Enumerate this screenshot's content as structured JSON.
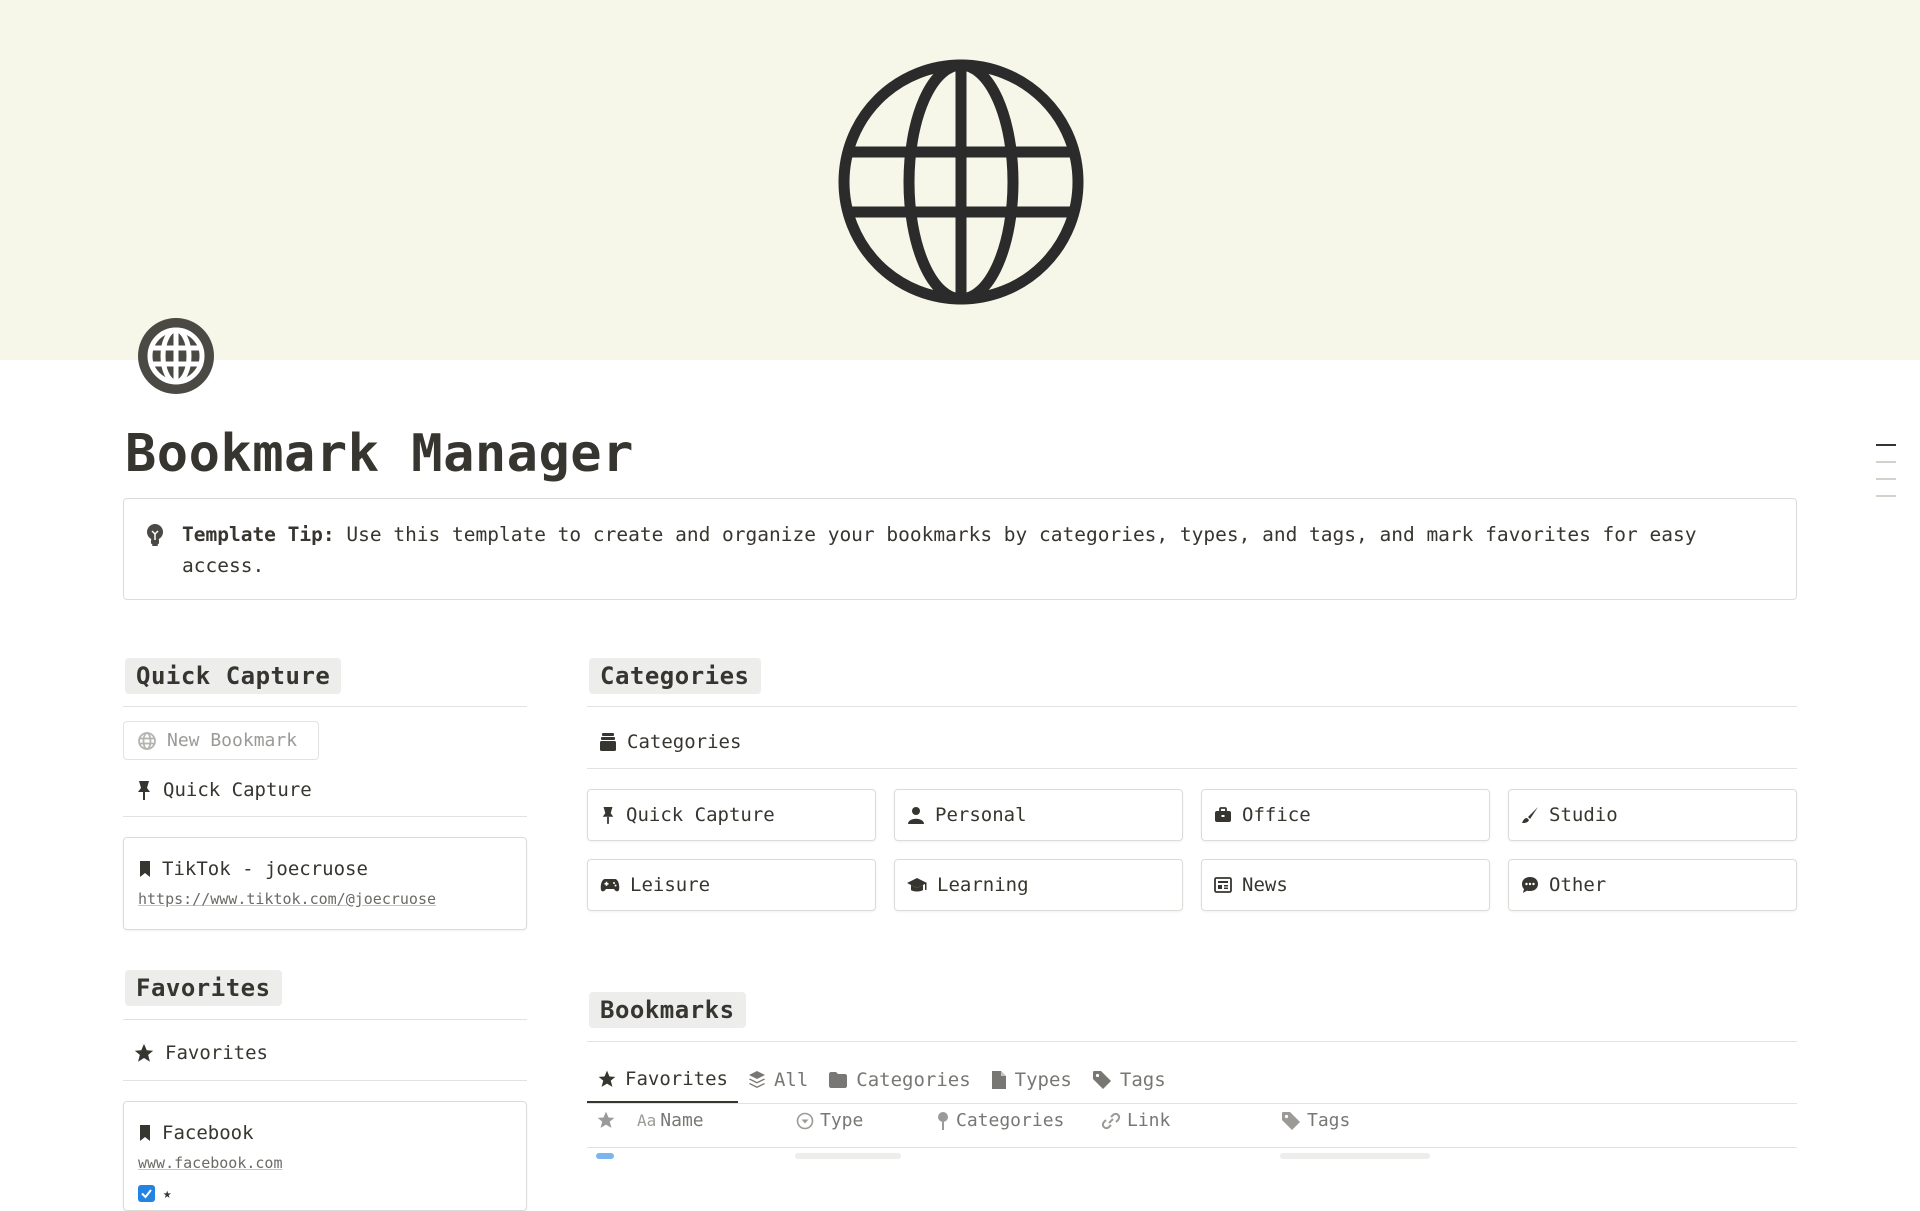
{
  "page": {
    "title": "Bookmark Manager",
    "icon": "globe-icon"
  },
  "callout": {
    "icon": "lightbulb-icon",
    "label": "Template Tip:",
    "text": " Use this template to create and organize your bookmarks by categories, types, and tags, and mark favorites for easy access."
  },
  "quick_capture": {
    "heading": "Quick Capture",
    "new_button": "New Bookmark",
    "view_name": "Quick Capture",
    "card": {
      "title": "TikTok - joecruose",
      "link": "https://www.tiktok.com/@joecruose"
    }
  },
  "favorites": {
    "heading": "Favorites",
    "view_name": "Favorites",
    "card": {
      "title": "Facebook",
      "link": "www.facebook.com",
      "favorite_checked": true,
      "favorite_mark": "★"
    }
  },
  "categories": {
    "heading": "Categories",
    "view_name": "Categories",
    "items": [
      {
        "label": "Quick Capture",
        "icon": "pin-icon"
      },
      {
        "label": "Personal",
        "icon": "person-icon"
      },
      {
        "label": "Office",
        "icon": "briefcase-icon"
      },
      {
        "label": "Studio",
        "icon": "paintbrush-icon"
      },
      {
        "label": "Leisure",
        "icon": "gamepad-icon"
      },
      {
        "label": "Learning",
        "icon": "graduation-cap-icon"
      },
      {
        "label": "News",
        "icon": "newspaper-icon"
      },
      {
        "label": "Other",
        "icon": "chat-bubble-icon"
      }
    ]
  },
  "bookmarks": {
    "heading": "Bookmarks",
    "tabs": [
      {
        "label": "Favorites",
        "icon": "star-icon",
        "active": true
      },
      {
        "label": "All",
        "icon": "layers-icon",
        "active": false
      },
      {
        "label": "Categories",
        "icon": "folder-icon",
        "active": false
      },
      {
        "label": "Types",
        "icon": "document-icon",
        "active": false
      },
      {
        "label": "Tags",
        "icon": "tag-icon",
        "active": false
      }
    ],
    "columns": [
      {
        "label": "",
        "icon": "star-icon"
      },
      {
        "label": "Name",
        "icon": "text-aa-icon"
      },
      {
        "label": "Type",
        "icon": "select-icon"
      },
      {
        "label": "Categories",
        "icon": "relation-pin-icon"
      },
      {
        "label": "Link",
        "icon": "link-icon"
      },
      {
        "label": "Tags",
        "icon": "tag-icon"
      }
    ]
  },
  "colors": {
    "cover_background": "#f6f6e9",
    "text": "#37352f",
    "muted_text": "#787774",
    "heading_highlight": "#ededeb",
    "border": "#dcdbd8",
    "checkbox_blue": "#2383e2"
  }
}
